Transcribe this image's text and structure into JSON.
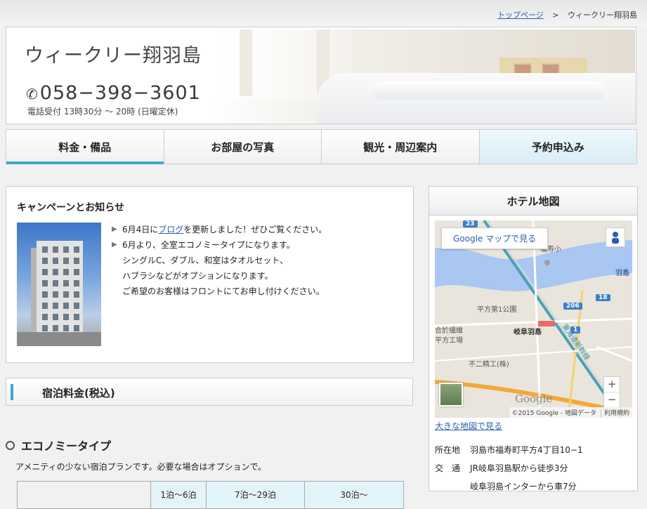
{
  "breadcrumb": {
    "home": "トップページ",
    "separator": ">",
    "current": "ウィークリー翔羽島"
  },
  "header": {
    "title": "ウィークリー翔羽島",
    "phone": "058−398−3601",
    "phone_hours": "電話受付 13時30分 ～ 20時 (日曜定休)"
  },
  "nav": {
    "items": [
      "料金・備品",
      "お部屋の写真",
      "観光・周辺案内",
      "予約申込み"
    ],
    "active_index": 0
  },
  "news": {
    "title": "キャンペーンとお知らせ",
    "item1_prefix": "6月4日に",
    "item1_link": "ブログ",
    "item1_suffix": "を更新しました！ぜひご覧ください。",
    "item2_lines": [
      "6月より、全室エコノミータイプになります。",
      "シングルC、ダブル、和室はタオルセット、",
      "ハブラシなどがオプションになります。",
      "ご希望のお客様はフロントにてお申し付けください。"
    ]
  },
  "price": {
    "heading": "宿泊料金(税込)",
    "type_title": "エコノミータイプ",
    "type_desc": "アメニティの少ない宿泊プランです。必要な場合はオプションで。",
    "columns": [
      "",
      "1泊～6泊",
      "7泊～29泊",
      "30泊～"
    ]
  },
  "map": {
    "title": "ホテル地図",
    "view_button": "Google マップで見る",
    "zoom_in": "+",
    "zoom_out": "−",
    "logo": "Google",
    "attribution": "©2015 Google - 地図データ",
    "terms": "利用規約",
    "labels": {
      "school": "福寿小",
      "park": "平方第1公園",
      "station": "岐阜羽島",
      "company": "不二精工(株)",
      "factory": "合於繊維",
      "factory2": "平方工場",
      "town": "福寿",
      "hashima": "羽島",
      "rail": "東海道新幹線",
      "shields": [
        "23",
        "206",
        "18",
        "1"
      ]
    },
    "large_link": "大きな地図で見る"
  },
  "address": {
    "label1": "所在地",
    "value1": "羽島市福寿町平方4丁目10−1",
    "label2": "交　通",
    "value2": "JR岐阜羽島駅から徒歩3分",
    "value3": "岐阜羽島インターから車7分"
  },
  "colors": {
    "accent": "#3aa9cf",
    "link": "#2a5db0",
    "reserve_bg": "#d9eef7"
  },
  "icons": {
    "phone": "phone-icon",
    "bullet": "triangle-right-icon",
    "pegman": "pegman-icon"
  }
}
